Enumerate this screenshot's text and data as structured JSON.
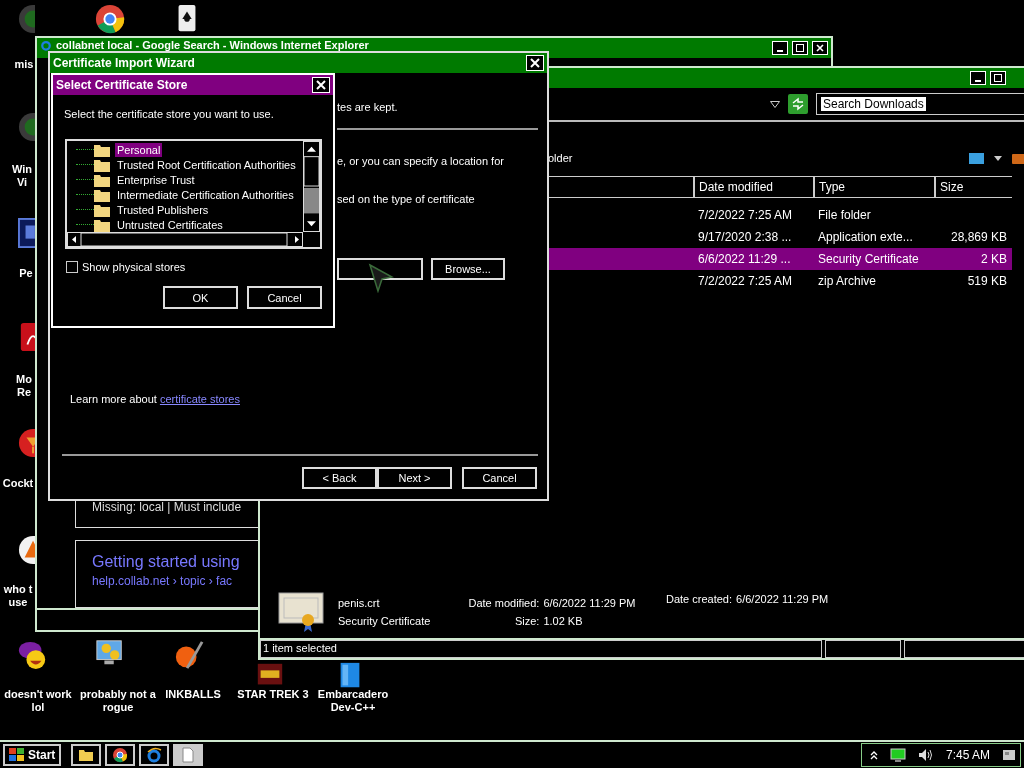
{
  "desktop_icons": [
    {
      "kind": "disc",
      "label": "mis"
    },
    {
      "kind": "chrome"
    },
    {
      "kind": "cards"
    },
    {
      "kind": "disc",
      "label": "Win Vi"
    },
    {
      "kind": "ps",
      "label": "Pe"
    },
    {
      "kind": "pdf",
      "label": "Mo Re"
    },
    {
      "kind": "cocktail",
      "label": "Cockt"
    },
    {
      "kind": "warning",
      "label": "who t use"
    },
    {
      "kind": "yahoo",
      "label": "doesn't work lol"
    },
    {
      "kind": "gears",
      "label": "probably not a rogue"
    },
    {
      "kind": "ball",
      "label": "INKBALLS"
    },
    {
      "kind": "starwars",
      "label": "STAR TREK 3"
    },
    {
      "kind": "ide",
      "label": "Embarcadero Dev-C++"
    }
  ],
  "browser_window": {
    "title": "collabnet local - Google Search - Windows Internet Explorer",
    "results": [
      {
        "snippet": "Missing: local | Must include"
      },
      {
        "heading": "Getting started using",
        "url": "help.collab.net › topic › fac"
      }
    ]
  },
  "explorer_window": {
    "search": {
      "value": "Search Downloads"
    },
    "toolbar_text": "older",
    "columns": [
      "Date modified",
      "Type",
      "Size"
    ],
    "rows": [
      {
        "date": "7/2/2022 7:25 AM",
        "type": "File folder",
        "selected": false
      },
      {
        "date": "9/17/2020 2:38 ...",
        "type": "Application exte...",
        "size": "28,869 KB",
        "selected": false
      },
      {
        "date": "6/6/2022 11:29 ...",
        "type": "Security Certificate",
        "size": "2 KB",
        "selected": true
      },
      {
        "date": "7/2/2022 7:25 AM",
        "type": "zip Archive",
        "size": "519 KB",
        "selected": false
      }
    ],
    "details": {
      "name": "penis.crt",
      "type": "Security Certificate",
      "modified_label": "Date modified:",
      "modified": "6/6/2022 11:29 PM",
      "size_label": "Size:",
      "size": "1.02 KB",
      "created_label": "Date created:",
      "created": "6/6/2022 11:29 PM"
    },
    "status_bar": "1 item selected"
  },
  "import_wizard": {
    "title": "Certificate Import Wizard",
    "text_fragments": [
      "tes are kept.",
      "e, or you can specify a location for",
      "sed on the type of certificate"
    ],
    "browse_button": "Browse...",
    "learn_more": "Learn more about",
    "learn_more_link": "certificate stores",
    "buttons": [
      "< Back",
      "Next >",
      "Cancel"
    ]
  },
  "store_dialog": {
    "title": "Select Certificate Store",
    "prompt": "Select the certificate store you want to use.",
    "stores": [
      {
        "label": "Personal",
        "selected": true
      },
      {
        "label": "Trusted Root Certification Authorities",
        "selected": false
      },
      {
        "label": "Enterprise Trust",
        "selected": false
      },
      {
        "label": "Intermediate Certification Authorities",
        "selected": false
      },
      {
        "label": "Trusted Publishers",
        "selected": false
      },
      {
        "label": "Untrusted Certificates",
        "selected": false
      }
    ],
    "show_physical_stores": {
      "label": "Show physical stores",
      "checked": false
    },
    "buttons": [
      "OK",
      "Cancel"
    ]
  },
  "taskbar": {
    "start": "Start",
    "buttons": [
      {
        "kind": "folder",
        "selected": false
      },
      {
        "kind": "chrome",
        "selected": false
      },
      {
        "kind": "ie",
        "selected": false
      },
      {
        "kind": "document",
        "selected": true
      }
    ],
    "clock": "7:45 AM"
  }
}
